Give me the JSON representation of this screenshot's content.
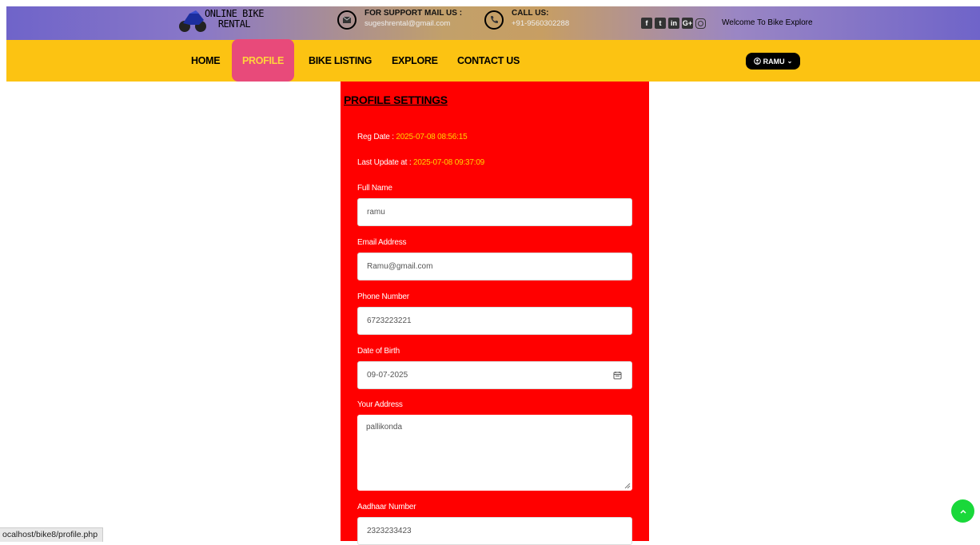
{
  "brand": {
    "line1": "ONLINE BIKE",
    "line2": "RENTAL"
  },
  "support": {
    "title": "FOR SUPPORT MAIL US :",
    "email": "sugeshrental@gmail.com"
  },
  "call": {
    "title": "CALL US:",
    "phone": "+91-9560302288"
  },
  "social": {
    "icons": [
      "facebook-icon",
      "twitter-icon",
      "linkedin-icon",
      "google-plus-icon",
      "instagram-icon"
    ],
    "welcome": "Welcome To Bike Explore"
  },
  "nav": {
    "home": "HOME",
    "profile": "PROFILE",
    "bike_listing": "BIKE LISTING",
    "explore": "EXPLORE",
    "contact": "CONTACT US",
    "user": "RAMU"
  },
  "profile": {
    "title": "PROFILE SETTINGS",
    "reg_label": "Reg Date : ",
    "reg_value": "2025-07-08 08:56:15",
    "update_label": "Last Update at : ",
    "update_value": "2025-07-08 09:37:09",
    "full_name_label": "Full Name",
    "full_name": "ramu",
    "email_label": "Email Address",
    "email": "Ramu@gmail.com",
    "phone_label": "Phone Number",
    "phone": "6723223221",
    "dob_label": "Date of Birth",
    "dob": "09-07-2025",
    "address_label": "Your Address",
    "address": "pallikonda",
    "aadhaar_label": "Aadhaar Number",
    "aadhaar": "2323233423"
  },
  "status_bar": "ocalhost/bike8/profile.php",
  "colors": {
    "nav": "#fcc312",
    "panel": "#ff0000",
    "active": "#e84a7a",
    "highlight": "#ffd400",
    "to_top": "#19d83a"
  }
}
